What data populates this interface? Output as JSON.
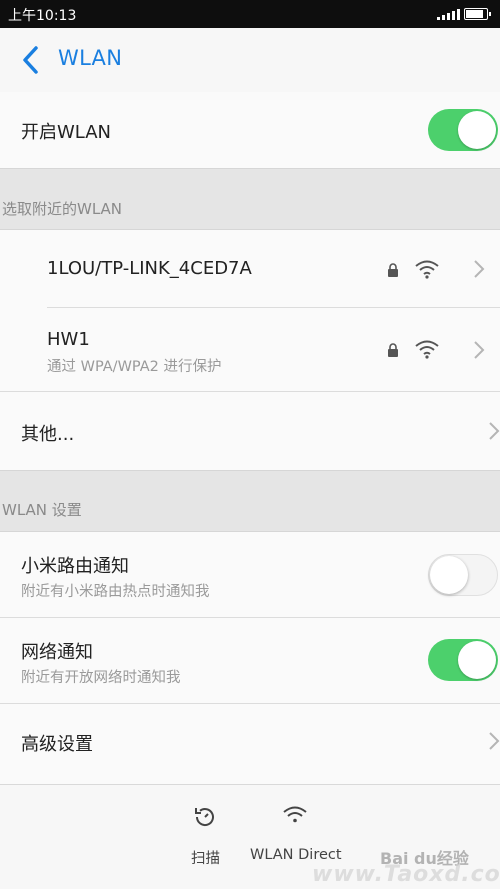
{
  "status_bar": {
    "time": "上午10:13"
  },
  "header": {
    "title": "WLAN"
  },
  "wlan_toggle": {
    "label": "开启WLAN",
    "state": "on"
  },
  "section_nearby": {
    "label": "选取附近的WLAN"
  },
  "networks": [
    {
      "ssid": "1LOU/TP-LINK_4CED7A",
      "subtitle": "",
      "secured": true,
      "signal": "full"
    },
    {
      "ssid": "HW1",
      "subtitle": "通过 WPA/WPA2 进行保护",
      "secured": true,
      "signal": "full"
    }
  ],
  "other": {
    "label": "其他..."
  },
  "section_settings": {
    "label": "WLAN 设置"
  },
  "settings": [
    {
      "title": "小米路由通知",
      "subtitle": "附近有小米路由热点时通知我",
      "state": "off"
    },
    {
      "title": "网络通知",
      "subtitle": "附近有开放网络时通知我",
      "state": "on"
    }
  ],
  "advanced": {
    "label": "高级设置"
  },
  "bottom_actions": [
    {
      "label": "扫描",
      "icon": "scan-icon"
    },
    {
      "label": "WLAN Direct",
      "icon": "wifi-direct-icon"
    }
  ],
  "watermark": {
    "text": "Bai du经验",
    "site": "www.Taoxd.com"
  },
  "colors": {
    "accent": "#1a7fe0",
    "toggle_on": "#4cd06c",
    "section_bg": "#e5e5e5"
  }
}
